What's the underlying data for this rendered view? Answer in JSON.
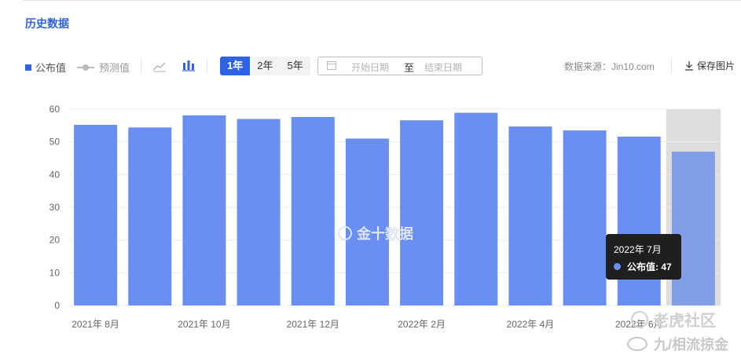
{
  "section_title": "历史数据",
  "toolbar": {
    "legend_published": "公布值",
    "legend_forecast": "预测值",
    "range_buttons": [
      "1年",
      "2年",
      "5年"
    ],
    "active_range": "1年",
    "date_start_placeholder": "开始日期",
    "date_separator": "至",
    "date_end_placeholder": "结束日期",
    "source": "数据来源：Jin10.com",
    "save_label": "保存图片"
  },
  "watermark": "金十数据",
  "tooltip": {
    "title": "2022年 7月",
    "series_name": "公布值",
    "value_text": "公布值: 47"
  },
  "overlay": {
    "line1": "老虎社区",
    "line2": "九/相流掠金"
  },
  "colors": {
    "accent": "#2f63e0",
    "bar": "#6a8ff2",
    "bar_highlight": "#829ee6",
    "highlight_band": "#dddddd"
  },
  "chart_data": {
    "type": "bar",
    "x_tick_labels": [
      "2021年 8月",
      "2021年 10月",
      "2021年 12月",
      "2022年 2月",
      "2022年 4月",
      "2022年 6月"
    ],
    "series": [
      {
        "name": "公布值",
        "x": [
          "2021-08",
          "2021-09",
          "2021-10",
          "2021-11",
          "2021-12",
          "2022-01",
          "2022-02",
          "2022-03",
          "2022-04",
          "2022-05",
          "2022-06",
          "2022-07"
        ],
        "values": [
          55.2,
          54.4,
          58.1,
          57.0,
          57.6,
          51.0,
          56.6,
          58.9,
          54.7,
          53.5,
          51.6,
          47.0
        ]
      }
    ],
    "ylim": [
      0,
      60
    ],
    "yticks": [
      0,
      10,
      20,
      30,
      40,
      50,
      60
    ],
    "highlighted_index": 11,
    "grid": true,
    "legend": "top-left"
  }
}
